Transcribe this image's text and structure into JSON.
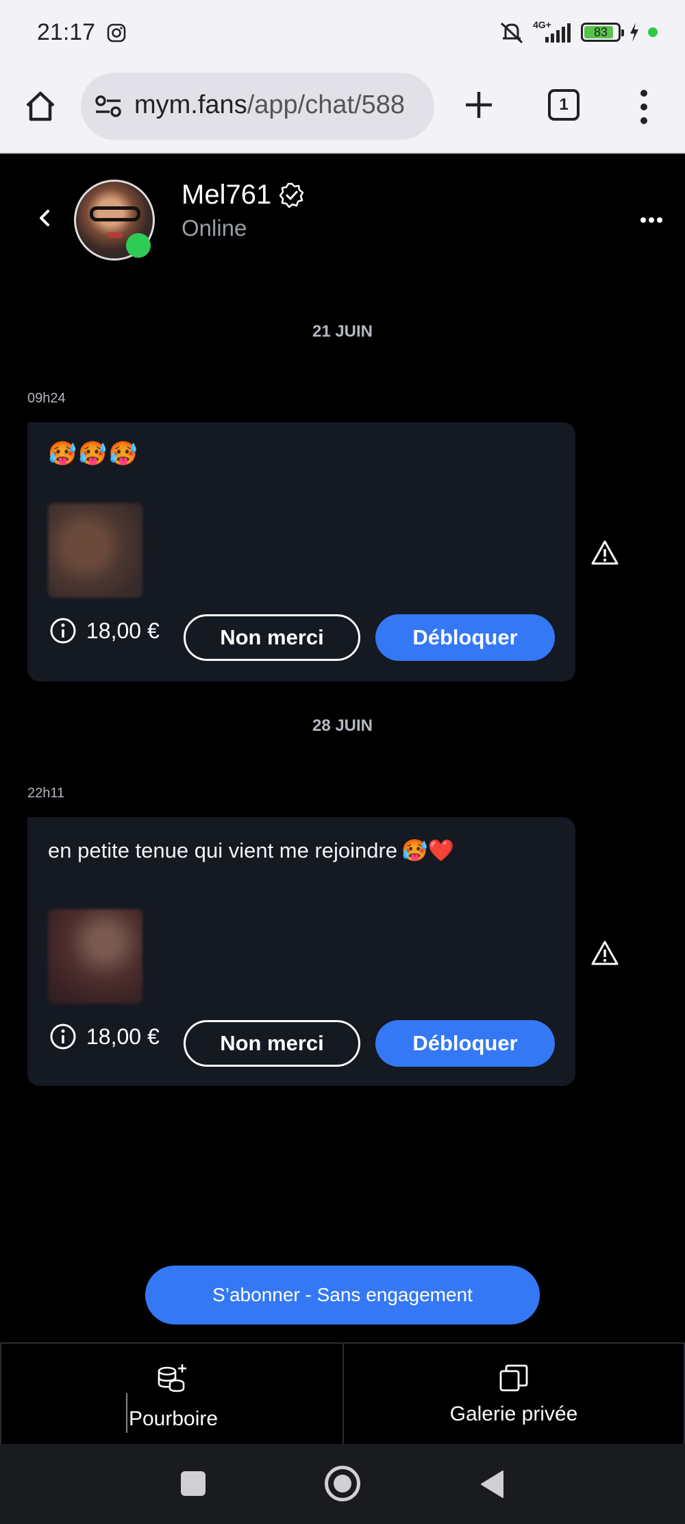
{
  "status_bar": {
    "time": "21:17",
    "battery": "83",
    "network": "4G+"
  },
  "browser": {
    "url_main": "mym.fans",
    "url_path": "/app/chat/588",
    "tab_count": "1"
  },
  "chat": {
    "username": "Mel761",
    "status": "Online"
  },
  "conversation": {
    "days": [
      {
        "date": "21 JUIN",
        "time": "09h24",
        "emojis": [
          "🥵",
          "🥵",
          "🥵"
        ],
        "text": "",
        "price": "18,00 €",
        "decline_label": "Non merci",
        "unlock_label": "Débloquer"
      },
      {
        "date": "28 JUIN",
        "time": "22h11",
        "emojis": [],
        "text": "en petite tenue qui vient me rejoindre",
        "text_emojis": "🥵❤️",
        "price": "18,00 €",
        "decline_label": "Non merci",
        "unlock_label": "Débloquer"
      }
    ]
  },
  "subscribe": {
    "label": "S’abonner - Sans engagement"
  },
  "bottom_tabs": {
    "tip_label": "Pourboire",
    "gallery_label": "Galerie privée"
  },
  "colors": {
    "accent": "#3478f6",
    "online": "#2ecc55",
    "card": "#141922",
    "background": "#000000"
  },
  "icons": [
    "instagram-icon",
    "mute-icon",
    "signal-icon",
    "battery-icon",
    "charging-icon",
    "home-icon",
    "tune-icon",
    "plus-icon",
    "tabs-icon",
    "kebab-menu-icon",
    "back-icon",
    "verified-icon",
    "more-icon",
    "info-icon",
    "warning-icon",
    "coins-plus-icon",
    "gallery-icon"
  ]
}
